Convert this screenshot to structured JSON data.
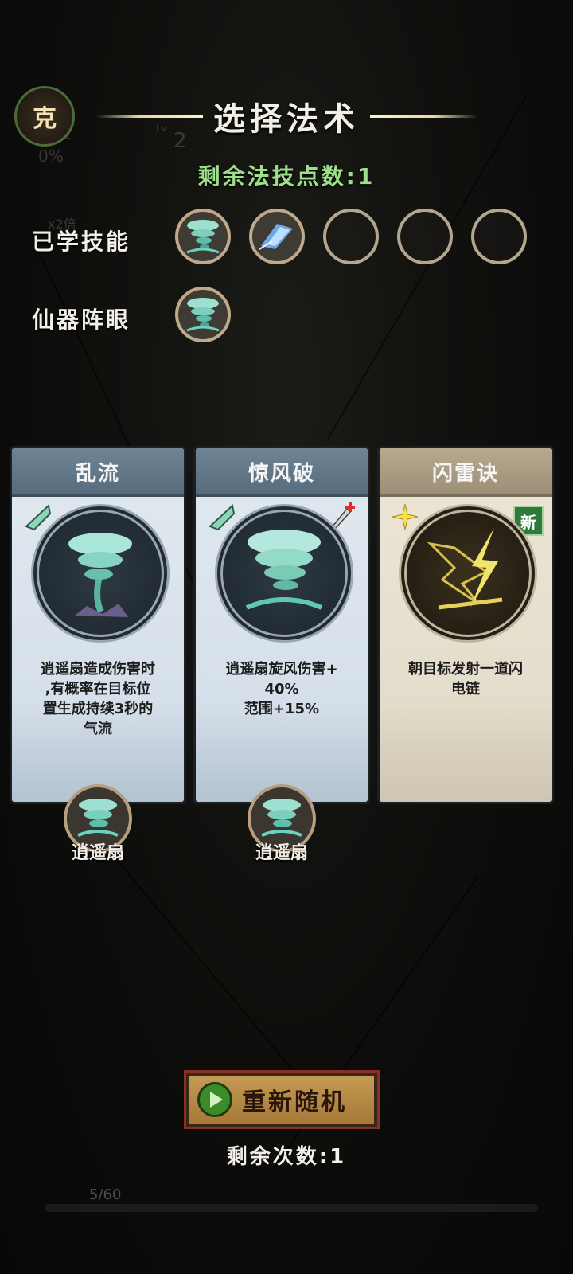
{
  "hud": {
    "progress_label": "度",
    "progress_value": "0%",
    "speed": "x2倍",
    "level": "2",
    "level_prefix": "Lv",
    "exp": "5/60"
  },
  "badge": {
    "text": "克"
  },
  "header": {
    "title": "选择法术",
    "points": "剩余法技点数:1"
  },
  "learned": {
    "label": "已学技能",
    "slots": [
      "tornado-icon",
      "ice-shard-icon",
      "",
      "",
      ""
    ]
  },
  "artifact": {
    "label": "仙器阵眼",
    "slots": [
      "tornado-icon"
    ]
  },
  "cards": [
    {
      "name": "乱流",
      "desc": [
        "逍遥扇造成伤害时",
        ",有概率在目标位",
        "置生成持续3秒的",
        "气流"
      ],
      "icon": "whirlwind-icon",
      "corner": "fan-corner-icon",
      "weapon": "逍遥扇"
    },
    {
      "name": "惊风破",
      "desc": [
        "逍遥扇旋风伤害+",
        "40%",
        "范围+15%"
      ],
      "icon": "tornado-icon",
      "corner": "fan-corner-icon",
      "weapon": "逍遥扇"
    },
    {
      "name": "闪雷诀",
      "desc": [
        "朝目标发射一道闪",
        "电链"
      ],
      "icon": "lightning-icon",
      "corner": "star-icon",
      "new_badge": "新"
    }
  ],
  "reroll": {
    "label": "重新随机",
    "remaining": "剩余次数:1"
  },
  "colors": {
    "points_green": "#9ee08a",
    "card_blue": "#566c7d",
    "card_gold": "#9c8f76",
    "button_gold": "#c49a55"
  }
}
